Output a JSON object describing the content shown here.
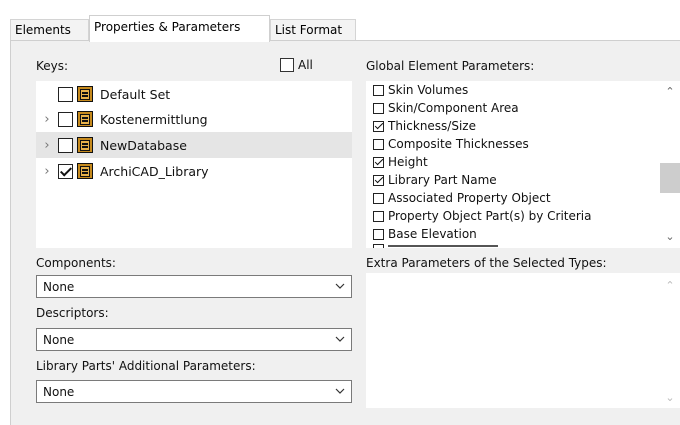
{
  "tabs": [
    {
      "label": "Elements"
    },
    {
      "label": "Properties & Parameters"
    },
    {
      "label": "List Format"
    }
  ],
  "keys": {
    "label": "Keys:",
    "all_label": "All",
    "all_checked": false,
    "items": [
      {
        "label": "Default Set",
        "checked": false,
        "expandable": false,
        "selected": false
      },
      {
        "label": "Kostenermittlung",
        "checked": false,
        "expandable": true,
        "selected": false
      },
      {
        "label": "NewDatabase",
        "checked": false,
        "expandable": true,
        "selected": true
      },
      {
        "label": "ArchiCAD_Library",
        "checked": true,
        "expandable": true,
        "selected": false
      }
    ]
  },
  "components": {
    "label": "Components:",
    "value": "None"
  },
  "descriptors": {
    "label": "Descriptors:",
    "value": "None"
  },
  "library_params": {
    "label": "Library Parts' Additional Parameters:",
    "value": "None"
  },
  "global_params": {
    "label": "Global Element Parameters:",
    "items": [
      {
        "label": "Skin Volumes",
        "checked": false
      },
      {
        "label": "Skin/Component Area",
        "checked": false
      },
      {
        "label": "Thickness/Size",
        "checked": true
      },
      {
        "label": "Composite Thicknesses",
        "checked": false
      },
      {
        "label": "Height",
        "checked": true
      },
      {
        "label": "Library Part Name",
        "checked": true
      },
      {
        "label": "Associated Property Object",
        "checked": false
      },
      {
        "label": "Property Object Part(s) by Criteria",
        "checked": false
      },
      {
        "label": "Base Elevation",
        "checked": false
      }
    ]
  },
  "extra_params": {
    "label": "Extra Parameters of the Selected Types:"
  }
}
